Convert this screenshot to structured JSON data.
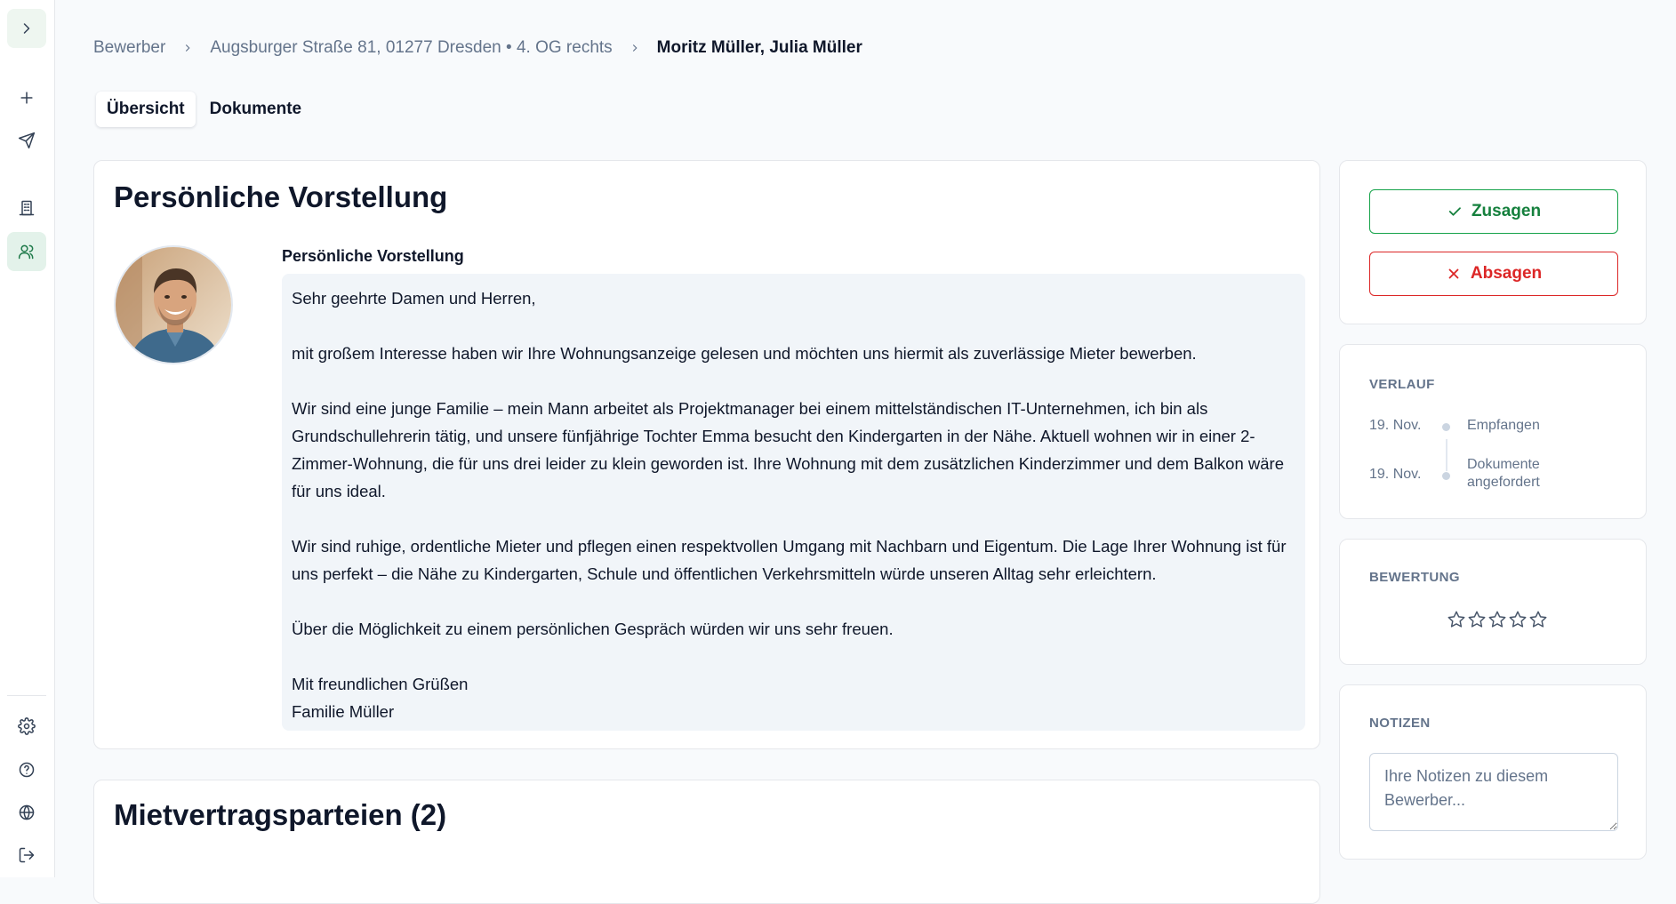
{
  "sidebar": {
    "icons": [
      "chevron-right-icon",
      "plus-icon",
      "send-icon",
      "building-icon",
      "users-icon",
      "settings-icon",
      "help-icon",
      "globe-icon",
      "logout-icon"
    ],
    "active_item": "users"
  },
  "breadcrumb": {
    "items": [
      "Bewerber",
      "Augsburger Straße 81, 01277 Dresden • 4. OG rechts",
      "Moritz Müller, Julia Müller"
    ]
  },
  "tabs": [
    {
      "label": "Übersicht",
      "active": true
    },
    {
      "label": "Dokumente",
      "active": false
    }
  ],
  "intro": {
    "card_title": "Persönliche Vorstellung",
    "label": "Persönliche Vorstellung",
    "paragraphs": [
      "Sehr geehrte Damen und Herren,",
      "mit großem Interesse haben wir Ihre Wohnungsanzeige gelesen und möchten uns hiermit als zuverlässige Mieter bewerben.",
      "Wir sind eine junge Familie – mein Mann arbeitet als Projektmanager bei einem mittelständischen IT-Unternehmen, ich bin als Grundschullehrerin tätig, und unsere fünfjährige Tochter Emma besucht den Kindergarten in der Nähe. Aktuell wohnen wir in einer 2-Zimmer-Wohnung, die für uns drei leider zu klein geworden ist. Ihre Wohnung mit dem zusätzlichen Kinderzimmer und dem Balkon wäre für uns ideal.",
      "Wir sind ruhige, ordentliche Mieter und pflegen einen respektvollen Umgang mit Nachbarn und Eigentum. Die Lage Ihrer Wohnung ist für uns perfekt – die Nähe zu Kindergarten, Schule und öffentlichen Verkehrsmitteln würde unseren Alltag sehr erleichtern.",
      "Über die Möglichkeit zu einem persönlichen Gespräch würden wir uns sehr freuen.",
      "Mit freundlichen Grüßen",
      "Familie Müller"
    ]
  },
  "parties": {
    "title": "Mietvertragsparteien (2)"
  },
  "actions": {
    "accept_label": "Zusagen",
    "reject_label": "Absagen",
    "accept_color": "#16a34a",
    "reject_color": "#dc2626"
  },
  "history": {
    "title": "VERLAUF",
    "events": [
      {
        "date": "19. Nov.",
        "label": "Empfangen"
      },
      {
        "date": "19. Nov.",
        "label": "Dokumente angefordert"
      }
    ]
  },
  "rating": {
    "title": "BEWERTUNG",
    "value": 0,
    "max": 5
  },
  "notes": {
    "title": "NOTIZEN",
    "placeholder": "Ihre Notizen zu diesem Bewerber...",
    "value": ""
  }
}
